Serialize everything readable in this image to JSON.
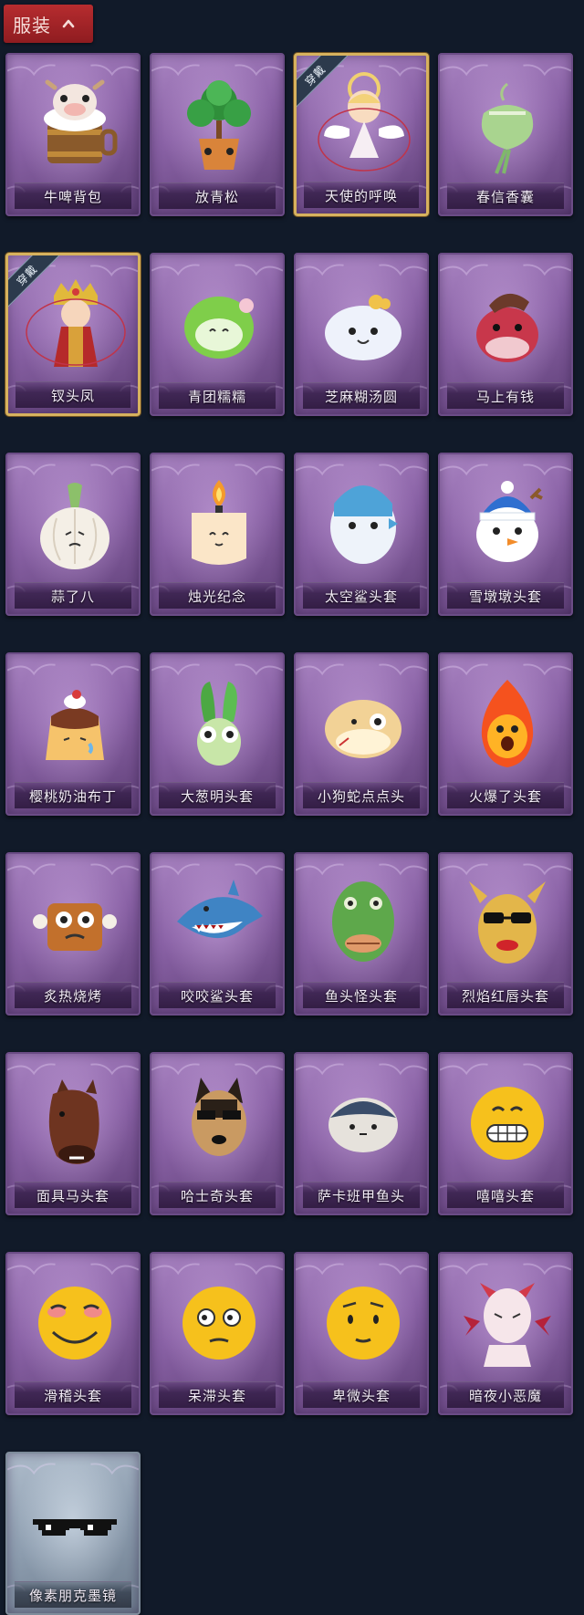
{
  "header": {
    "title": "服装",
    "icon": "chevron-up-icon"
  },
  "worn_badge": "穿戴",
  "items": [
    {
      "label": "牛啤背包",
      "icon": "cow-beer-backpack-icon",
      "worn": false
    },
    {
      "label": "放青松",
      "icon": "bonsai-pine-icon",
      "worn": false
    },
    {
      "label": "天使的呼唤",
      "icon": "angel-costume-icon",
      "worn": true
    },
    {
      "label": "春信香囊",
      "icon": "sachet-pouch-icon",
      "worn": false
    },
    {
      "label": "钗头凤",
      "icon": "phoenix-crown-costume-icon",
      "worn": true
    },
    {
      "label": "青团糯糯",
      "icon": "green-rice-ball-icon",
      "worn": false
    },
    {
      "label": "芝麻糊汤圆",
      "icon": "sesame-dumpling-icon",
      "worn": false
    },
    {
      "label": "马上有钱",
      "icon": "red-horse-icon",
      "worn": false
    },
    {
      "label": "蒜了八",
      "icon": "garlic-icon",
      "worn": false
    },
    {
      "label": "烛光纪念",
      "icon": "candle-icon",
      "worn": false
    },
    {
      "label": "太空鲨头套",
      "icon": "space-shark-head-icon",
      "worn": false
    },
    {
      "label": "雪墩墩头套",
      "icon": "snowman-head-icon",
      "worn": false
    },
    {
      "label": "樱桃奶油布丁",
      "icon": "pudding-icon",
      "worn": false
    },
    {
      "label": "大葱明头套",
      "icon": "scallion-head-icon",
      "worn": false
    },
    {
      "label": "小狗蛇点点头",
      "icon": "snake-dog-head-icon",
      "worn": false
    },
    {
      "label": "火爆了头套",
      "icon": "fire-head-icon",
      "worn": false
    },
    {
      "label": "炙热烧烤",
      "icon": "bbq-meat-icon",
      "worn": false
    },
    {
      "label": "咬咬鲨头套",
      "icon": "biting-shark-head-icon",
      "worn": false
    },
    {
      "label": "鱼头怪头套",
      "icon": "fish-head-mask-icon",
      "worn": false
    },
    {
      "label": "烈焰红唇头套",
      "icon": "red-lips-mask-icon",
      "worn": false
    },
    {
      "label": "面具马头套",
      "icon": "horse-mask-icon",
      "worn": false
    },
    {
      "label": "哈士奇头套",
      "icon": "husky-head-icon",
      "worn": false
    },
    {
      "label": "萨卡班甲鱼头",
      "icon": "sacabambaspis-head-icon",
      "worn": false
    },
    {
      "label": "嘻嘻头套",
      "icon": "grin-emoji-head-icon",
      "worn": false
    },
    {
      "label": "滑稽头套",
      "icon": "smirk-emoji-head-icon",
      "worn": false
    },
    {
      "label": "呆滞头套",
      "icon": "dazed-emoji-head-icon",
      "worn": false
    },
    {
      "label": "卑微头套",
      "icon": "humble-emoji-head-icon",
      "worn": false
    },
    {
      "label": "暗夜小恶魔",
      "icon": "little-devil-icon",
      "worn": false
    },
    {
      "label": "像素朋克墨镜",
      "icon": "pixel-sunglasses-icon",
      "worn": false
    }
  ],
  "colors": {
    "card_purple": "#8a62a6",
    "card_gray": "#8d9daf",
    "worn_border": "#d7b25e",
    "header_red": "#a82529",
    "background": "#111a29"
  }
}
